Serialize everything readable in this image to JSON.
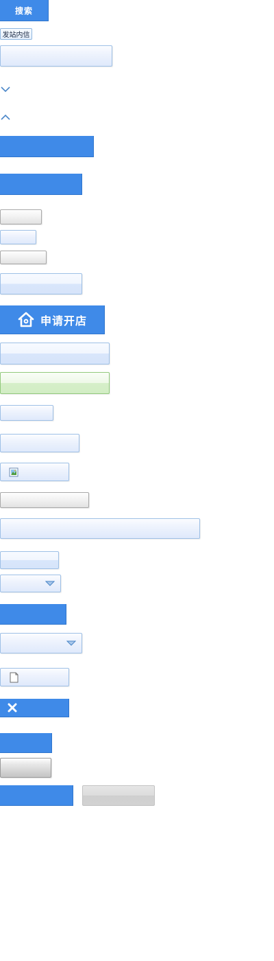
{
  "buttons": {
    "search_label": "搜索",
    "send_message_label": "发站内信",
    "apply_shop_label": "申请开店"
  },
  "icons": {
    "arrow_down": "chevron-down-icon",
    "arrow_up": "chevron-up-icon",
    "house": "house-icon",
    "image": "image-icon",
    "document": "document-icon",
    "close": "close-icon",
    "dropdown": "dropdown-arrow-icon"
  },
  "colors": {
    "blue_primary": "#3f8ae8",
    "blue_border": "#9ec0e6",
    "green_border": "#92c97c",
    "gray_border": "#a9a9a9"
  }
}
